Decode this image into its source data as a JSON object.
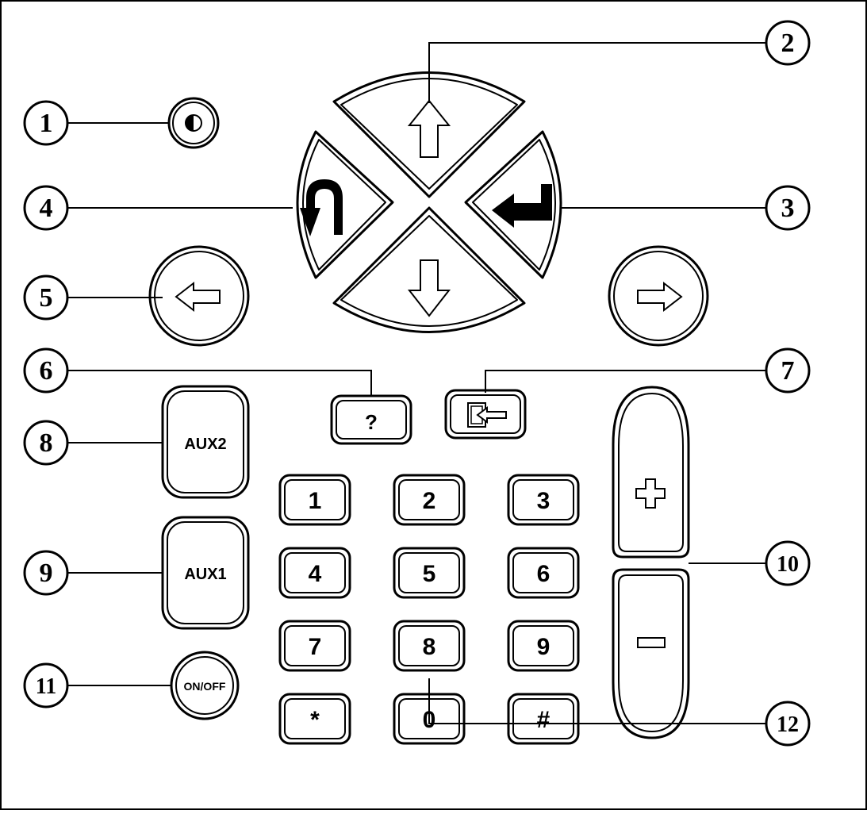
{
  "callouts": {
    "c1": "1",
    "c2": "2",
    "c3": "3",
    "c4": "4",
    "c5": "5",
    "c6": "6",
    "c7": "7",
    "c8": "8",
    "c9": "9",
    "c10": "10",
    "c11": "11",
    "c12": "12"
  },
  "buttons": {
    "help": "?",
    "aux2": "AUX2",
    "aux1": "AUX1",
    "onoff": "ON/OFF"
  },
  "keypad": [
    "1",
    "2",
    "3",
    "4",
    "5",
    "6",
    "7",
    "8",
    "9",
    "*",
    "0",
    "#"
  ],
  "icons": {
    "backlight": "contrast-icon",
    "up": "arrow-up-icon",
    "down": "arrow-down-icon",
    "left": "arrow-left-icon",
    "right": "arrow-right-icon",
    "back": "u-turn-back-icon",
    "enter": "enter-icon",
    "exit": "exit-icon",
    "plus": "plus-icon",
    "minus": "minus-icon"
  }
}
